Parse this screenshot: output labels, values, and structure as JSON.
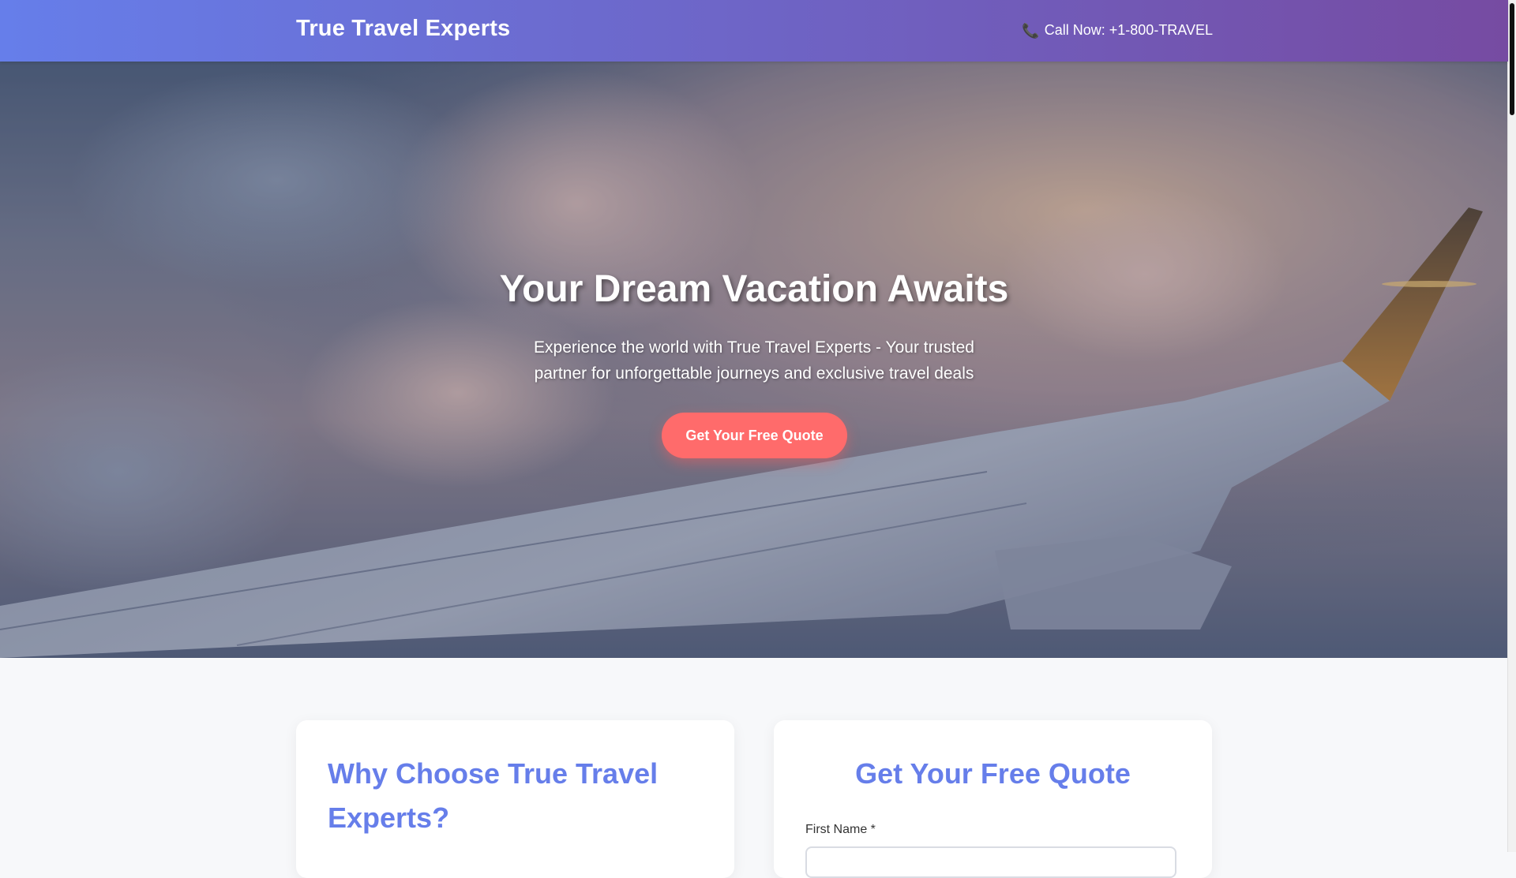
{
  "header": {
    "logo": "True Travel Experts",
    "call_label": "Call Now: +1-800-TRAVEL",
    "phone_icon": "phone-icon"
  },
  "hero": {
    "title": "Your Dream Vacation Awaits",
    "subtitle": "Experience the world with True Travel Experts - Your trusted partner for unforgettable journeys and exclusive travel deals",
    "cta_label": "Get Your Free Quote"
  },
  "why_card": {
    "title": "Why Choose True Travel Experts?"
  },
  "quote_form": {
    "title": "Get Your Free Quote",
    "first_name_label": "First Name *",
    "first_name_value": ""
  },
  "colors": {
    "header_gradient_start": "#667eea",
    "header_gradient_end": "#764ba2",
    "accent": "#667eea",
    "cta": "#ff6b6b"
  }
}
